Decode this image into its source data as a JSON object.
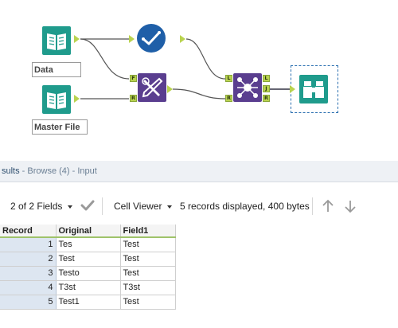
{
  "canvas": {
    "tools": {
      "data_input": {
        "label": "Data"
      },
      "master_input": {
        "label": "Master File"
      },
      "join": {
        "left": "L",
        "right": "R",
        "join": "J"
      },
      "fuzzy": {
        "left": "F",
        "right": "R"
      }
    }
  },
  "results": {
    "header_title": "sults",
    "header_rest": " - Browse (4) - Input",
    "toolbar": {
      "fields": "2 of 2 Fields",
      "viewer": "Cell Viewer",
      "status": "5 records displayed, 400 bytes"
    },
    "table": {
      "columns": [
        "Record",
        "Original",
        "Field1"
      ],
      "rows": [
        {
          "record": "1",
          "original": "Tes",
          "field1": "Test"
        },
        {
          "record": "2",
          "original": "Test",
          "field1": "Test"
        },
        {
          "record": "3",
          "original": "Testo",
          "field1": "Test"
        },
        {
          "record": "4",
          "original": "T3st",
          "field1": "T3st"
        },
        {
          "record": "5",
          "original": "Test1",
          "field1": "Test"
        }
      ]
    }
  },
  "colors": {
    "teal": "#1f9b8c",
    "navy": "#1f5fa8",
    "purple": "#5a3e8f",
    "anchor": "#b9d34f"
  }
}
